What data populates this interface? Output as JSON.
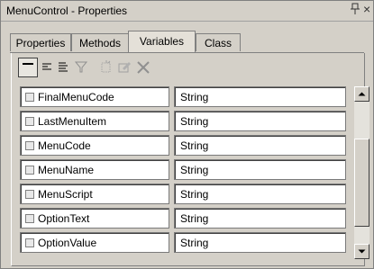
{
  "window": {
    "title": "MenuControl - Properties",
    "pin_glyph": "⍄",
    "close_glyph": "×"
  },
  "tabs": [
    {
      "label": "Properties",
      "active": false
    },
    {
      "label": "Methods",
      "active": false
    },
    {
      "label": "Variables",
      "active": true
    },
    {
      "label": "Class",
      "active": false
    }
  ],
  "toolbar": {
    "icons": [
      "view-single-icon",
      "align-left-icon",
      "list-icon",
      "filter-icon",
      "new-item-icon",
      "edit-icon",
      "delete-icon"
    ]
  },
  "variables": [
    {
      "name": "FinalMenuCode",
      "type": "String"
    },
    {
      "name": "LastMenuItem",
      "type": "String"
    },
    {
      "name": "MenuCode",
      "type": "String"
    },
    {
      "name": "MenuName",
      "type": "String"
    },
    {
      "name": "MenuScript",
      "type": "String"
    },
    {
      "name": "OptionText",
      "type": "String"
    },
    {
      "name": "OptionValue",
      "type": "String"
    }
  ]
}
